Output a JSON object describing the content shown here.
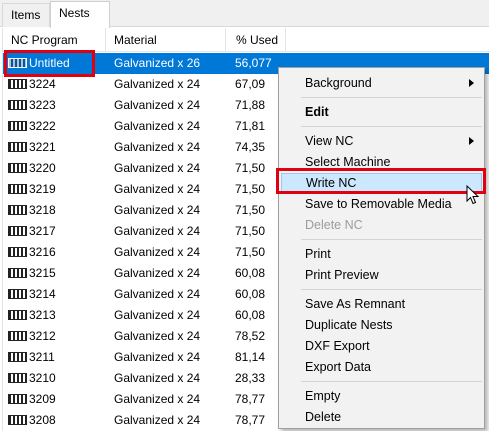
{
  "tabs": [
    {
      "label": "Items",
      "active": false
    },
    {
      "label": "Nests",
      "active": true
    }
  ],
  "grid": {
    "columns": [
      "NC Program",
      "Material",
      "% Used"
    ],
    "rows": [
      {
        "program": "Untitled",
        "material": "Galvanized x 26",
        "used": "56,077"
      },
      {
        "program": "3224",
        "material": "Galvanized x 24",
        "used": "67,09"
      },
      {
        "program": "3223",
        "material": "Galvanized x 24",
        "used": "71,88"
      },
      {
        "program": "3222",
        "material": "Galvanized x 24",
        "used": "71,81"
      },
      {
        "program": "3221",
        "material": "Galvanized x 24",
        "used": "74,35"
      },
      {
        "program": "3220",
        "material": "Galvanized x 24",
        "used": "71,50"
      },
      {
        "program": "3219",
        "material": "Galvanized x 24",
        "used": "71,50"
      },
      {
        "program": "3218",
        "material": "Galvanized x 24",
        "used": "71,50"
      },
      {
        "program": "3217",
        "material": "Galvanized x 24",
        "used": "71,50"
      },
      {
        "program": "3216",
        "material": "Galvanized x 24",
        "used": "71,50"
      },
      {
        "program": "3215",
        "material": "Galvanized x 24",
        "used": "60,08"
      },
      {
        "program": "3214",
        "material": "Galvanized x 24",
        "used": "60,08"
      },
      {
        "program": "3213",
        "material": "Galvanized x 24",
        "used": "60,08"
      },
      {
        "program": "3212",
        "material": "Galvanized x 24",
        "used": "78,52"
      },
      {
        "program": "3211",
        "material": "Galvanized x 24",
        "used": "81,14"
      },
      {
        "program": "3210",
        "material": "Galvanized x 24",
        "used": "28,33"
      },
      {
        "program": "3209",
        "material": "Galvanized x 24",
        "used": "78,77"
      },
      {
        "program": "3208",
        "material": "Galvanized x 24",
        "used": "78,77"
      }
    ]
  },
  "context_menu": {
    "background": "Background",
    "edit": "Edit",
    "view_nc": "View NC",
    "select_machine": "Select Machine",
    "write_nc": "Write NC",
    "save_removable": "Save to Removable Media",
    "delete_nc": "Delete NC",
    "print": "Print",
    "print_preview": "Print Preview",
    "save_remnant": "Save As Remnant",
    "duplicate_nests": "Duplicate Nests",
    "dxf_export": "DXF Export",
    "export_data": "Export Data",
    "empty": "Empty",
    "delete": "Delete"
  },
  "colors": {
    "selection": "#0078d7",
    "highlight_box": "#e0000f",
    "menu_hover": "#cce8ff"
  }
}
